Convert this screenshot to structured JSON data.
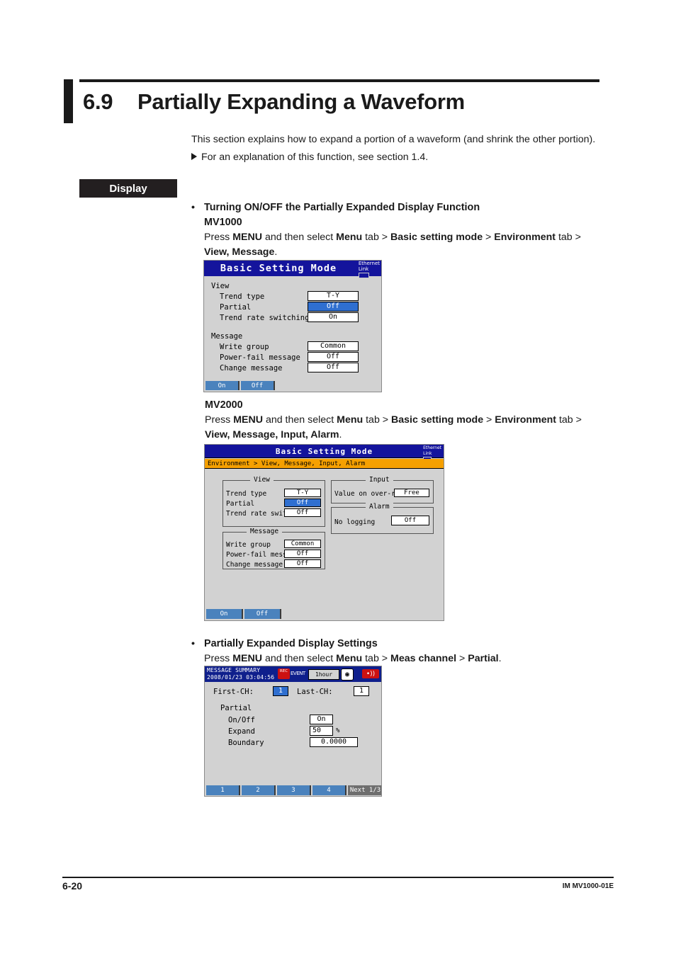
{
  "heading": {
    "number": "6.9",
    "title": "Partially Expanding a Waveform"
  },
  "intro": {
    "paragraph": "This section explains how to expand a portion of a waveform (and shrink the other portion).",
    "reference": "For an explanation of this function, see section 1.4."
  },
  "display_tag": "Display",
  "blocks": {
    "b1": {
      "bullet": "•",
      "heading": "Turning ON/OFF the Partially Expanded Display Function",
      "model": "MV1000",
      "instr_1": "Press ",
      "instr_2": "MENU",
      "instr_3": " and then select ",
      "instr_4": "Menu",
      "instr_5": " tab > ",
      "instr_6": "Basic setting mode",
      "instr_7": " > ",
      "instr_8": "Environment",
      "instr_9": " tab >",
      "instr_10": "View, Message",
      "instr_11": "."
    },
    "b2": {
      "model": "MV2000",
      "instr_1": "Press ",
      "instr_2": "MENU",
      "instr_3": " and then select ",
      "instr_4": "Menu",
      "instr_5": " tab > ",
      "instr_6": "Basic setting mode",
      "instr_7": " > ",
      "instr_8": "Environment",
      "instr_9": " tab >",
      "instr_10": "View, Message, Input, Alarm",
      "instr_11": "."
    },
    "b3": {
      "bullet": "•",
      "heading": "Partially Expanded Display Settings",
      "instr_1": "Press ",
      "instr_2": "MENU",
      "instr_3": " and then select ",
      "instr_4": "Menu",
      "instr_5": " tab > ",
      "instr_6": "Meas channel",
      "instr_7": " > ",
      "instr_8": "Partial",
      "instr_9": "."
    }
  },
  "device1": {
    "title": "Basic Setting Mode",
    "ethernet": {
      "line1": "Ethernet",
      "line2": "Link"
    },
    "view_group": "View",
    "rows": [
      {
        "label": "Trend type",
        "value": "T-Y",
        "selected": false
      },
      {
        "label": "Partial",
        "value": "Off",
        "selected": true
      },
      {
        "label": "Trend rate switching",
        "value": "On",
        "selected": false
      }
    ],
    "message_group": "Message",
    "msg_rows": [
      {
        "label": "Write group",
        "value": "Common"
      },
      {
        "label": "Power-fail message",
        "value": "Off"
      },
      {
        "label": "Change message",
        "value": "Off"
      }
    ],
    "softkeys": [
      "On",
      "Off"
    ]
  },
  "device2": {
    "title": "Basic Setting Mode",
    "ethernet": {
      "line1": "Ethernet",
      "line2": "Link"
    },
    "breadcrumb": "Environment > View, Message, Input, Alarm",
    "view_group": "View",
    "view_rows": [
      {
        "label": "Trend type",
        "value": "T-Y",
        "selected": false
      },
      {
        "label": "Partial",
        "value": "Off",
        "selected": true
      },
      {
        "label": "Trend rate switching",
        "value": "Off",
        "selected": false
      }
    ],
    "message_group": "Message",
    "message_rows": [
      {
        "label": "Write group",
        "value": "Common"
      },
      {
        "label": "Power-fail message",
        "value": "Off"
      },
      {
        "label": "Change message",
        "value": "Off"
      }
    ],
    "input_group": "Input",
    "input_rows": [
      {
        "label": "Value on over-range",
        "value": "Free"
      }
    ],
    "alarm_group": "Alarm",
    "alarm_rows": [
      {
        "label": "No logging",
        "value": "Off"
      }
    ],
    "softkeys": [
      "On",
      "Off"
    ]
  },
  "device3": {
    "title_line1": "MESSAGE SUMMARY",
    "title_line2": "2008/01/23 03:04:56",
    "rec_icon_label": "REC",
    "event_label": "EVENT",
    "rate": "1hour",
    "gear_icon": "gear",
    "alarm_icon": "alarm",
    "first_ch_label": "First-CH:",
    "first_ch_value": "1",
    "last_ch_label": "Last-CH:",
    "last_ch_value": "1",
    "partial_group": "Partial",
    "rows": [
      {
        "label": "On/Off",
        "value": "On"
      },
      {
        "label": "Expand",
        "value": "50",
        "unit": "%"
      },
      {
        "label": "Boundary",
        "value": "0.0000"
      }
    ],
    "softkeys": [
      "1",
      "2",
      "3",
      "4"
    ],
    "next_key": "Next 1/3"
  },
  "footer": {
    "page": "6-20",
    "doc_id": "IM MV1000-01E"
  }
}
